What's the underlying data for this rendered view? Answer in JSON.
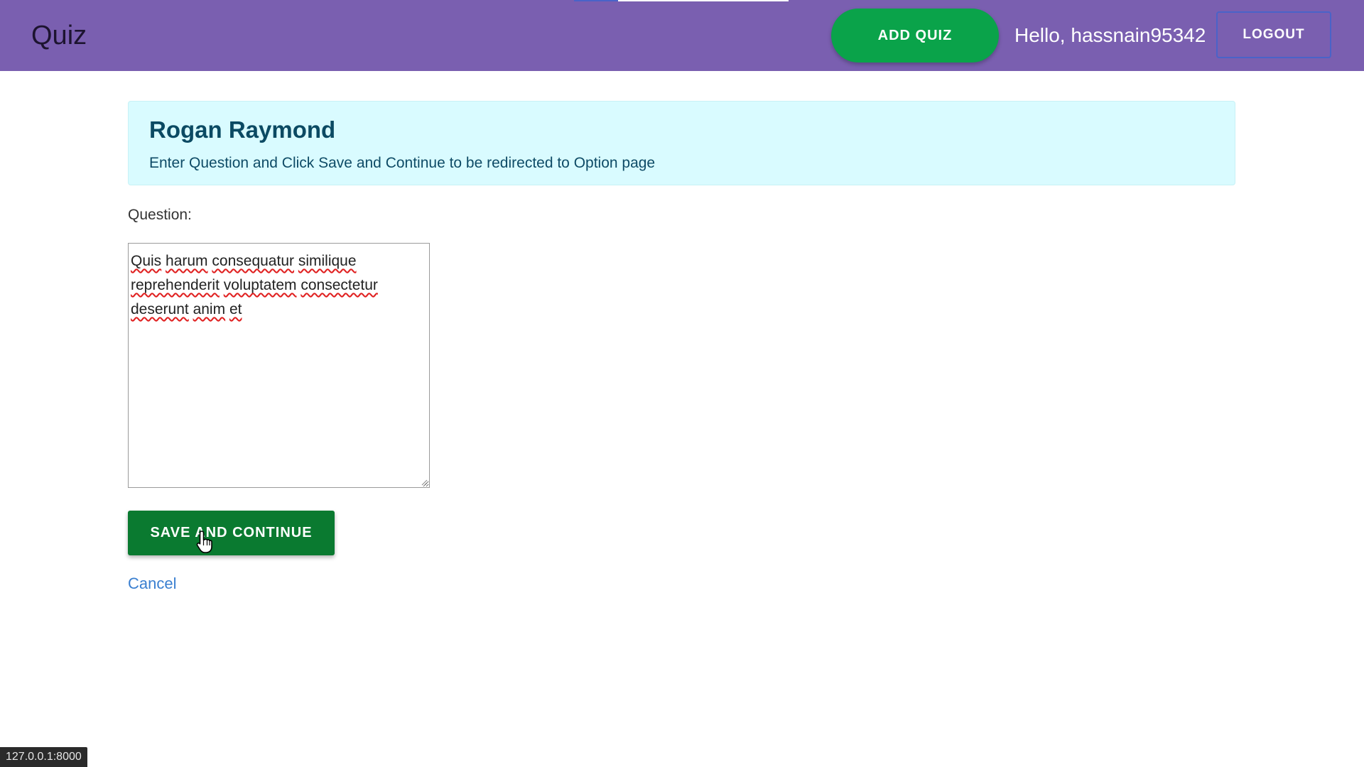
{
  "header": {
    "brand": "Quiz",
    "add_quiz_label": "ADD QUIZ",
    "greeting": "Hello, hassnain95342",
    "logout_label": "LOGOUT"
  },
  "alert": {
    "title": "Rogan Raymond",
    "text": "Enter Question and Click Save and Continue to be redirected to Option page"
  },
  "form": {
    "question_label": "Question:",
    "question_value": "Quis harum consequatur similique reprehenderit voluptatem consectetur deserunt anim et",
    "save_label": "SAVE AND CONTINUE",
    "cancel_label": "Cancel"
  },
  "status_bar": {
    "url": "127.0.0.1:8000"
  },
  "colors": {
    "navbar": "#7a5fb0",
    "add_quiz_button": "#0aa34a",
    "save_button": "#0a7a30",
    "alert_bg": "#d9fbff",
    "link": "#3a7fd0"
  },
  "icons": {
    "cursor": "hand-pointer-icon",
    "textarea_grip": "resize-grip-icon"
  }
}
